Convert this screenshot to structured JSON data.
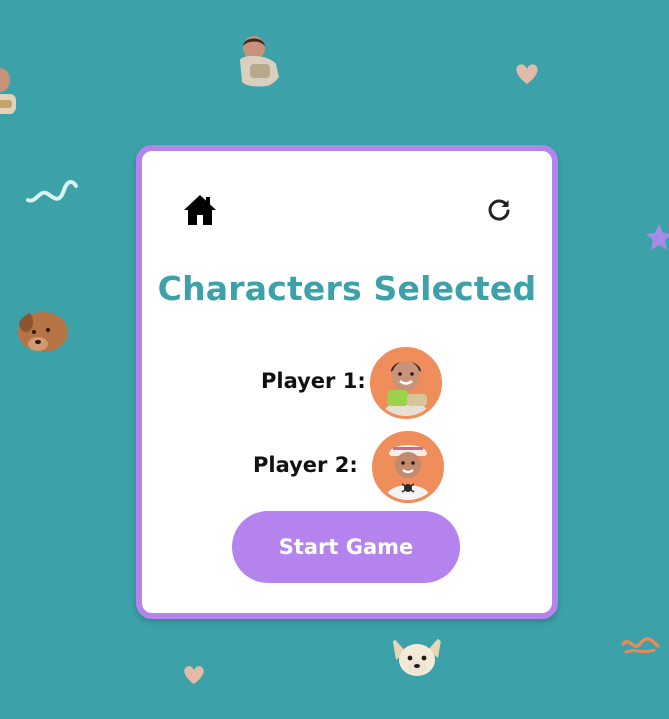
{
  "background": {
    "color": "#3ca1a8"
  },
  "card": {
    "border_color": "#b583ee",
    "title": "Characters Selected",
    "title_color": "#3ca1a8"
  },
  "nav": {
    "home_icon": "home-icon",
    "restart_icon": "restart-icon"
  },
  "players": [
    {
      "label": "Player 1:",
      "avatar": "player-1-avatar"
    },
    {
      "label": "Player 2:",
      "avatar": "player-2-avatar"
    }
  ],
  "start_button": {
    "label": "Start Game",
    "color": "#b583ee"
  },
  "accent_orange": "#ef8d5b"
}
